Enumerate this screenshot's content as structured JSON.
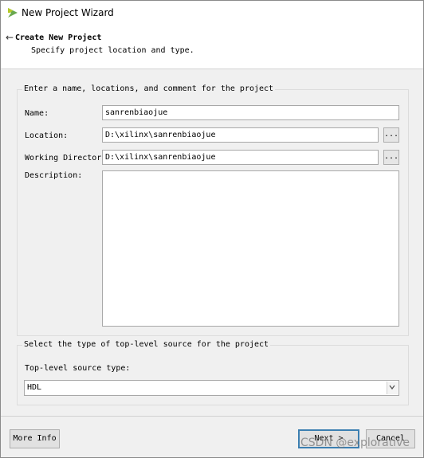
{
  "window": {
    "title": "New Project Wizard"
  },
  "header": {
    "back_icon": "←",
    "title": "Create New Project",
    "subtitle": "Specify project location and type."
  },
  "project_group": {
    "legend": "Enter a name, locations, and comment for the project",
    "name_label": "Name:",
    "name_value": "sanrenbiaojue",
    "location_label": "Location:",
    "location_value": "D:\\xilinx\\sanrenbiaojue",
    "working_dir_label": "Working Directory:",
    "working_dir_value": "D:\\xilinx\\sanrenbiaojue",
    "browse_label": "...",
    "description_label": "Description:",
    "description_value": ""
  },
  "source_group": {
    "legend": "Select the type of top-level source for the project",
    "type_label": "Top-level source type:",
    "type_value": "HDL"
  },
  "buttons": {
    "more_info": "More Info",
    "next": "Next >",
    "cancel": "Cancel"
  },
  "watermark": "CSDN @explorative",
  "colors": {
    "default_button_border": "#3c7fb1",
    "logo_green": "#6aa84f"
  }
}
